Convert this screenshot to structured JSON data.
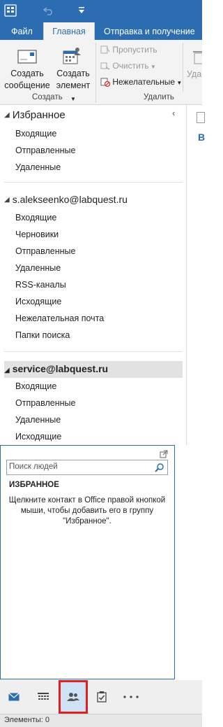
{
  "colors": {
    "brand": "#2b6db0",
    "selection_outline": "#e02020",
    "section_highlight": "#e2e2e2"
  },
  "titlebar": {
    "app_icon": "outlook-icon",
    "undo_icon": "undo-icon",
    "qa_icon": "customize-quick-access-icon"
  },
  "tabs": [
    {
      "label": "Файл"
    },
    {
      "label": "Главная",
      "active": true
    },
    {
      "label": "Отправка и получение"
    }
  ],
  "ribbon": {
    "new_message_label": "Создать сообщение",
    "new_message_line1": "Создать",
    "new_message_line2": "сообщение",
    "new_item_line1": "Создать",
    "new_item_line2": "элемент",
    "group_create": "Создать",
    "ignore": "Пропустить",
    "clean_up": "Очистить",
    "junk": "Нежелательные",
    "delete_truncated": "Уда",
    "group_delete": "Удалить"
  },
  "folders": {
    "favorites": {
      "title": "Избранное",
      "items": [
        "Входящие",
        "Отправленные",
        "Удаленные"
      ]
    },
    "account1": {
      "title": "s.alekseenko@labquest.ru",
      "items": [
        "Входящие",
        "Черновики",
        "Отправленные",
        "Удаленные",
        "RSS-каналы",
        "Исходящие",
        "Нежелательная почта",
        "Папки поиска"
      ]
    },
    "account2": {
      "title": "service@labquest.ru",
      "items": [
        "Входящие",
        "Отправленные",
        "Удаленные",
        "Исходящие"
      ]
    }
  },
  "people_peek": {
    "search_placeholder": "Поиск людей",
    "heading": "ИЗБРАННОЕ",
    "hint": "Щелкните контакт в Office правой кнопкой мыши, чтобы добавить его в группу \"Избранное\"."
  },
  "rightpane": {
    "partial_letter": "В"
  },
  "navbar": {
    "items": [
      "mail-icon",
      "calendar-icon",
      "people-icon",
      "tasks-icon",
      "more-icon"
    ],
    "selected": "people-icon"
  },
  "status": {
    "items_label": "Элементы: 0"
  }
}
